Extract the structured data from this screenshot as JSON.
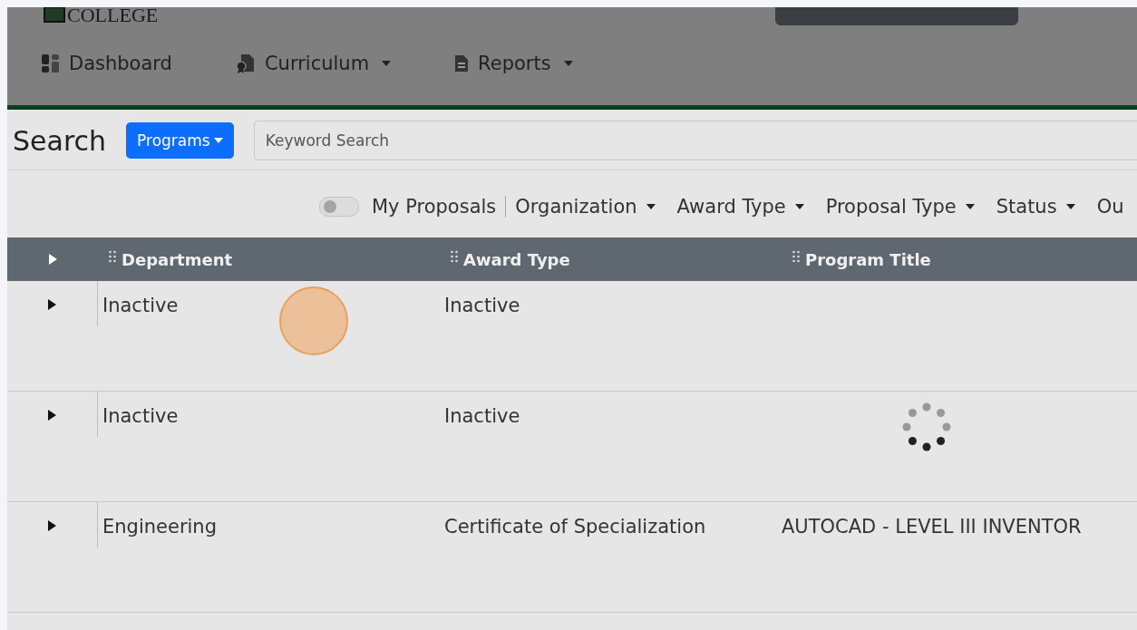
{
  "header": {
    "logo_text": "COLLEGE",
    "nav": [
      {
        "label": "Dashboard",
        "dropdown": false
      },
      {
        "label": "Curriculum",
        "dropdown": true
      },
      {
        "label": "Reports",
        "dropdown": true
      }
    ]
  },
  "search": {
    "title": "Search",
    "scope_button": "Programs",
    "placeholder": "Keyword Search"
  },
  "filters": {
    "my_proposals": {
      "label": "My Proposals",
      "on": false
    },
    "dropdowns": [
      "Organization",
      "Award Type",
      "Proposal Type",
      "Status",
      "Ou"
    ]
  },
  "table": {
    "columns": [
      "Department",
      "Award Type",
      "Program Title"
    ],
    "rows": [
      {
        "department": "Inactive",
        "award_type": "Inactive",
        "loading": false
      },
      {
        "department": "Inactive",
        "award_type": "Inactive",
        "loading": true
      },
      {
        "department": "Engineering",
        "award_type": "Certificate of Specialization",
        "program_title": "AUTOCAD - LEVEL III INVENTOR",
        "loading": false
      }
    ]
  }
}
